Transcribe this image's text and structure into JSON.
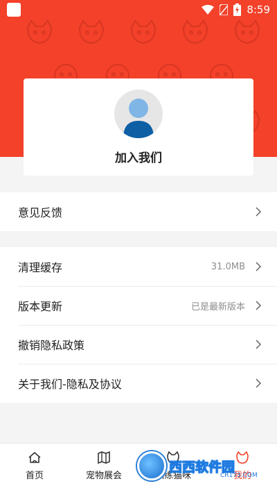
{
  "statusbar": {
    "time": "8:59"
  },
  "profile": {
    "join_label": "加入我们"
  },
  "sections": {
    "feedback": {
      "label": "意见反馈"
    },
    "cache": {
      "label": "清理缓存",
      "value": "31.0MB"
    },
    "version": {
      "label": "版本更新",
      "value": "已是最新版本"
    },
    "privacy_revoke": {
      "label": "撤销隐私政策"
    },
    "about": {
      "label": "关于我们-隐私及协议"
    }
  },
  "tabbar": {
    "items": [
      {
        "label": "首页",
        "icon": "home-icon"
      },
      {
        "label": "宠物展会",
        "icon": "map-icon"
      },
      {
        "label": "训练猫咪",
        "icon": "cat-icon"
      },
      {
        "label": "我的",
        "icon": "user-icon"
      }
    ]
  },
  "watermark": {
    "brand": "西西软件园",
    "domain": "CR173.COM"
  },
  "colors": {
    "header_red": "#f3412a",
    "avatar_blue": "#7fb6e6",
    "avatar_dark": "#0e5fa4"
  }
}
